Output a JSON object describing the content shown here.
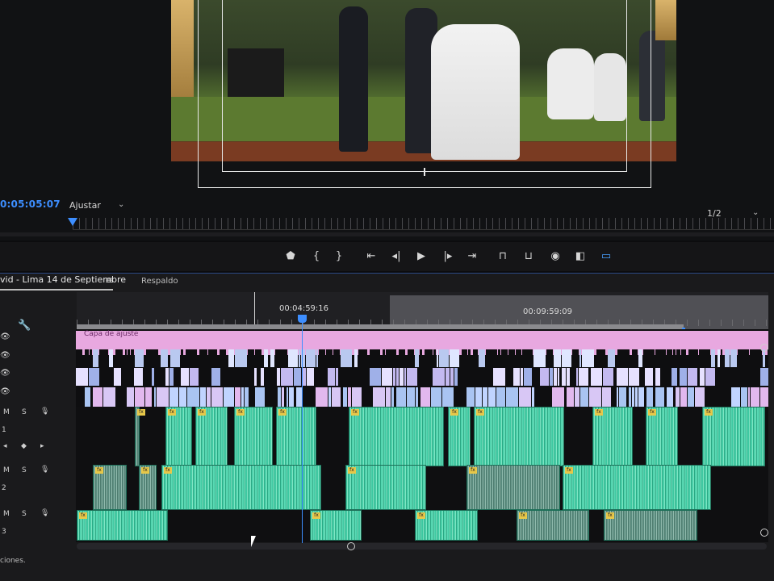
{
  "monitor": {
    "timecode": "0:05:05:07",
    "fit_label": "Ajustar",
    "resolution_label": "1/2"
  },
  "transport": {
    "buttons": [
      {
        "name": "marker-icon",
        "glyph": "⬟"
      },
      {
        "name": "mark-in-icon",
        "glyph": "{"
      },
      {
        "name": "mark-out-icon",
        "glyph": "}"
      },
      {
        "name": "go-to-in-icon",
        "glyph": "⇤"
      },
      {
        "name": "step-back-icon",
        "glyph": "◂|"
      },
      {
        "name": "play-icon",
        "glyph": "▶"
      },
      {
        "name": "step-forward-icon",
        "glyph": "|▸"
      },
      {
        "name": "go-to-out-icon",
        "glyph": "⇥"
      },
      {
        "name": "lift-icon",
        "glyph": "⊓"
      },
      {
        "name": "extract-icon",
        "glyph": "⊔"
      },
      {
        "name": "export-frame-icon",
        "glyph": "◉"
      },
      {
        "name": "comparison-view-icon",
        "glyph": "◧"
      },
      {
        "name": "safe-margins-icon",
        "glyph": "▭"
      }
    ]
  },
  "timeline": {
    "sequence_tab": "vid - Lima 14 de Septiembre",
    "menu_glyph": "≡",
    "second_tab": "Respaldo",
    "ruler_timecodes": [
      "00:04:59:16",
      "00:09:59:09"
    ],
    "adjustment_layer_label": "Capa de ajuste",
    "track_header_letters": {
      "mute": "M",
      "solo": "S"
    },
    "track_numbers": [
      "1",
      "2",
      "3"
    ],
    "status_text": "ciones."
  },
  "colors": {
    "accent": "#3d8eff",
    "audio_clip": "#3cc8a0",
    "adjustment_layer": "#e8a8e0",
    "fx_badge": "#e7c84a"
  }
}
